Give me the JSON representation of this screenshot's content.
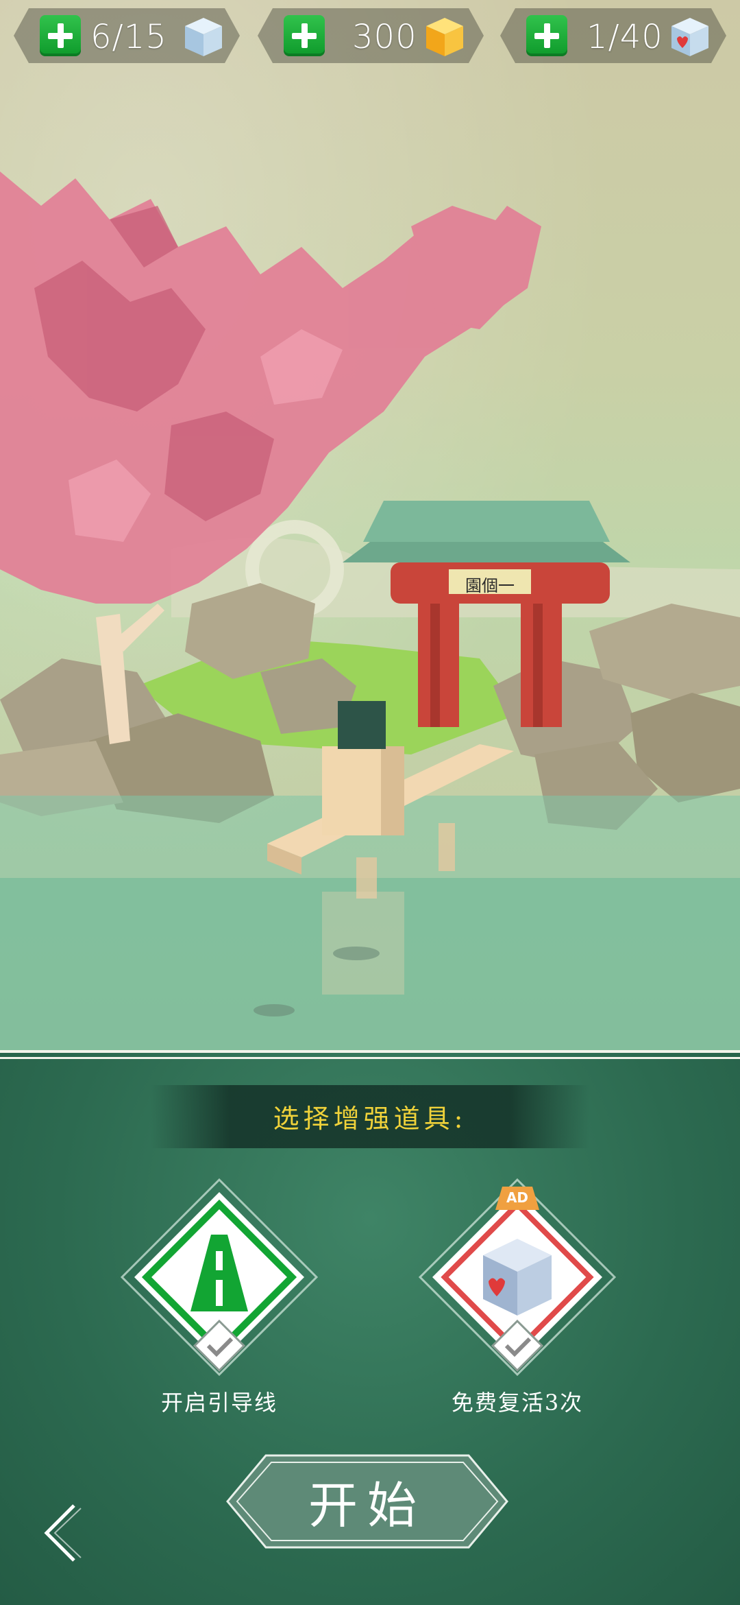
{
  "resources": [
    {
      "value": "6/15",
      "icon": "cube-icon"
    },
    {
      "value": "300",
      "icon": "gold-cube-icon"
    },
    {
      "value": "1/40",
      "icon": "heart-cube-icon"
    }
  ],
  "scene": {
    "gate_sign": "園個一"
  },
  "boosters": {
    "title": "选择增强道具:",
    "items": [
      {
        "label": "开启引导线",
        "icon": "road-icon",
        "badge": ""
      },
      {
        "label": "免费复活3次",
        "icon": "heart-cube-icon",
        "badge": "AD"
      }
    ]
  },
  "start_label": "开始",
  "colors": {
    "accent_green": "#12a533",
    "panel": "#2c6a50",
    "title_yellow": "#f0d23a",
    "heart_red": "#e03a3a"
  }
}
